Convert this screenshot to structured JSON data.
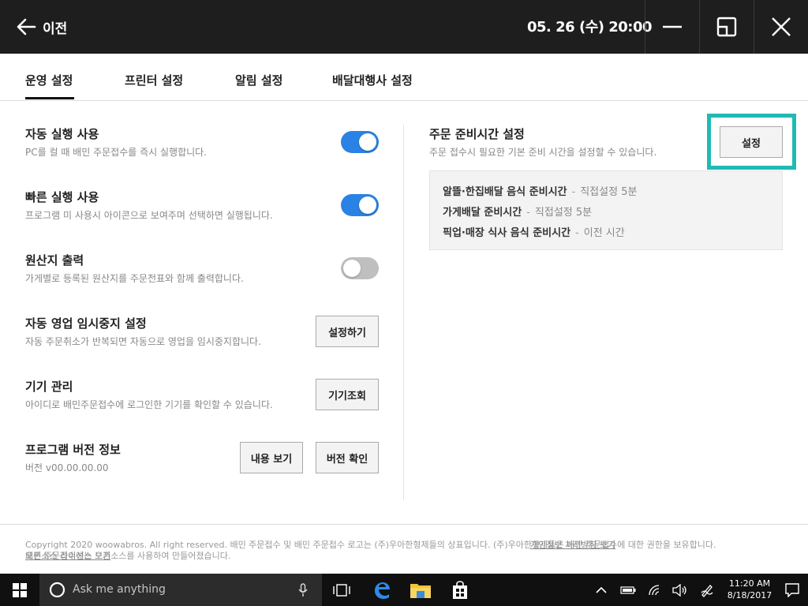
{
  "header": {
    "back_label": "이전",
    "datetime": "05. 26 (수) 20:00"
  },
  "tabs": [
    {
      "label": "운영 설정",
      "active": true
    },
    {
      "label": "프린터 설정",
      "active": false
    },
    {
      "label": "알림 설정",
      "active": false
    },
    {
      "label": "배달대행사 설정",
      "active": false
    }
  ],
  "settings": {
    "auto_run": {
      "title": "자동 실행 사용",
      "desc": "PC를 컬 때 배민 주문접수를 즉시 실행합니다.",
      "enabled": true
    },
    "quick_run": {
      "title": "빠른 실행 사용",
      "desc": "프로그램 미 사용시 아이콘으로 보여주며 선택하면 실행됩니다.",
      "enabled": true
    },
    "origin_print": {
      "title": "원산지 출력",
      "desc": "가게별로 등록된 원산지를 주문전표와 함께 출력합니다.",
      "enabled": false
    },
    "auto_pause": {
      "title": "자동 영업 임시중지 설정",
      "desc": "자동 주문취소가 반복되면 자동으로 영업을 임시중지합니다.",
      "button": "설정하기"
    },
    "devices": {
      "title": "기기 관리",
      "desc": "아이디로 배민주문접수에 로그인한 기기를 확인할 수 있습니다.",
      "button": "기기조회"
    },
    "version": {
      "title": "프로그램 버전 정보",
      "desc": "버전 v00.00.00.00",
      "button_view": "내용 보기",
      "button_check": "버전 확인"
    }
  },
  "prep_time": {
    "title": "주문 준비시간 설정",
    "desc": "주문 접수시 필요한 기본 준비 시간을 설정할 수 있습니다.",
    "button": "설정",
    "items": [
      {
        "label": "알뜰·한집배달 음식 준비시간",
        "value": "직접설정 5분"
      },
      {
        "label": "가게배달 준비시간",
        "value": "직접설정 5분"
      },
      {
        "label": "픽업·매장 식사 음식 준비시간",
        "value": "이전 시간"
      }
    ],
    "separator": "-"
  },
  "footer": {
    "copyright": "Copyright 2020 woowabros. All right reserved. 배민 주문접수 및 배민 주문접수 로고는 (주)우아한형제들의 상표입니다. (주)우아한형제들은 배민 주문접수에 대한 권한을 보유합니다.",
    "opensource": "배민 주문접수에는 오픈소스를 사용하여 만들어졌습니다.",
    "link_left": "오픈소스 라이선스 보기",
    "link_right": "개인정보 처리방침 보기"
  },
  "taskbar": {
    "search_placeholder": "Ask me anything",
    "time": "11:20 AM",
    "date": "8/18/2017"
  }
}
